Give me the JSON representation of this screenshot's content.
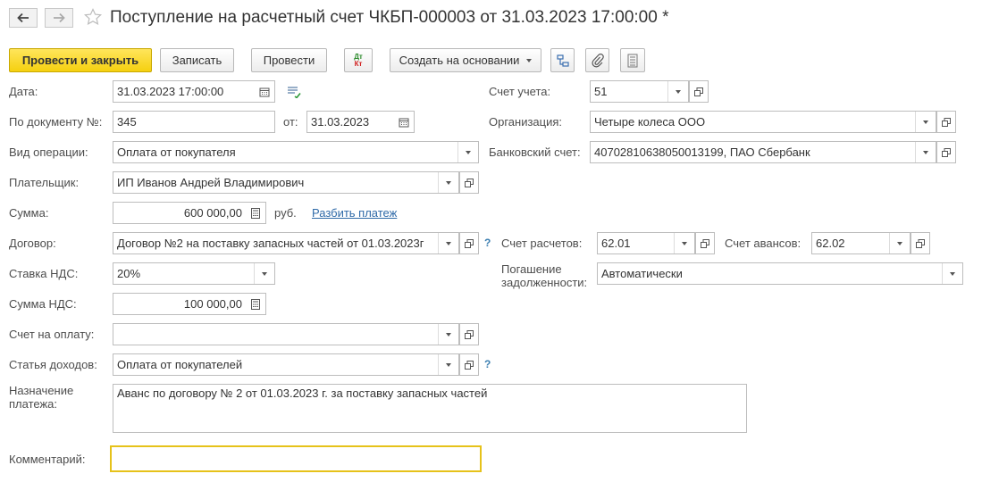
{
  "window": {
    "title": "Поступление на расчетный счет ЧКБП-000003 от 31.03.2023 17:00:00 *"
  },
  "toolbar": {
    "post_and_close": "Провести и закрыть",
    "save": "Записать",
    "post": "Провести",
    "dt_kt_icon_top": "Дт",
    "dt_kt_icon_bottom": "Кт",
    "create_based_on": "Создать на основании"
  },
  "form": {
    "date": {
      "label": "Дата:",
      "value": "31.03.2023 17:00:00"
    },
    "doc_number": {
      "label": "По документу №:",
      "value": "345",
      "from_label": "от:",
      "from_value": "31.03.2023"
    },
    "operation_type": {
      "label": "Вид операции:",
      "value": "Оплата от покупателя"
    },
    "payer": {
      "label": "Плательщик:",
      "value": "ИП Иванов Андрей Владимирович"
    },
    "amount": {
      "label": "Сумма:",
      "value": "600 000,00",
      "currency": "руб.",
      "split_link": "Разбить платеж"
    },
    "contract": {
      "label": "Договор:",
      "value": "Договор №2 на поставку запасных частей от 01.03.2023г"
    },
    "vat_rate": {
      "label": "Ставка НДС:",
      "value": "20%"
    },
    "vat_amount": {
      "label": "Сумма НДС:",
      "value": "100 000,00"
    },
    "invoice": {
      "label": "Счет на оплату:",
      "value": ""
    },
    "income_item": {
      "label": "Статья доходов:",
      "value": "Оплата от покупателей"
    },
    "purpose": {
      "label_line1": "Назначение",
      "label_line2": "платежа:",
      "value": "Аванс по договору № 2 от 01.03.2023 г. за поставку запасных частей"
    },
    "comment": {
      "label": "Комментарий:",
      "value": ""
    },
    "account": {
      "label": "Счет учета:",
      "value": "51"
    },
    "organization": {
      "label": "Организация:",
      "value": "Четыре колеса ООО"
    },
    "bank_account": {
      "label": "Банковский счет:",
      "value": "40702810638050013199, ПАО Сбербанк"
    },
    "settlement_account": {
      "label": "Счет расчетов:",
      "value": "62.01"
    },
    "advance_account": {
      "label": "Счет авансов:",
      "value": "62.02"
    },
    "debt_repayment": {
      "label_line1": "Погашение",
      "label_line2": "задолженности:",
      "value": "Автоматически"
    }
  },
  "help_glyph": "?",
  "colors": {
    "primary_button": "#f5d00f",
    "link": "#2f6aa8",
    "comment_border": "#e6c21a"
  }
}
